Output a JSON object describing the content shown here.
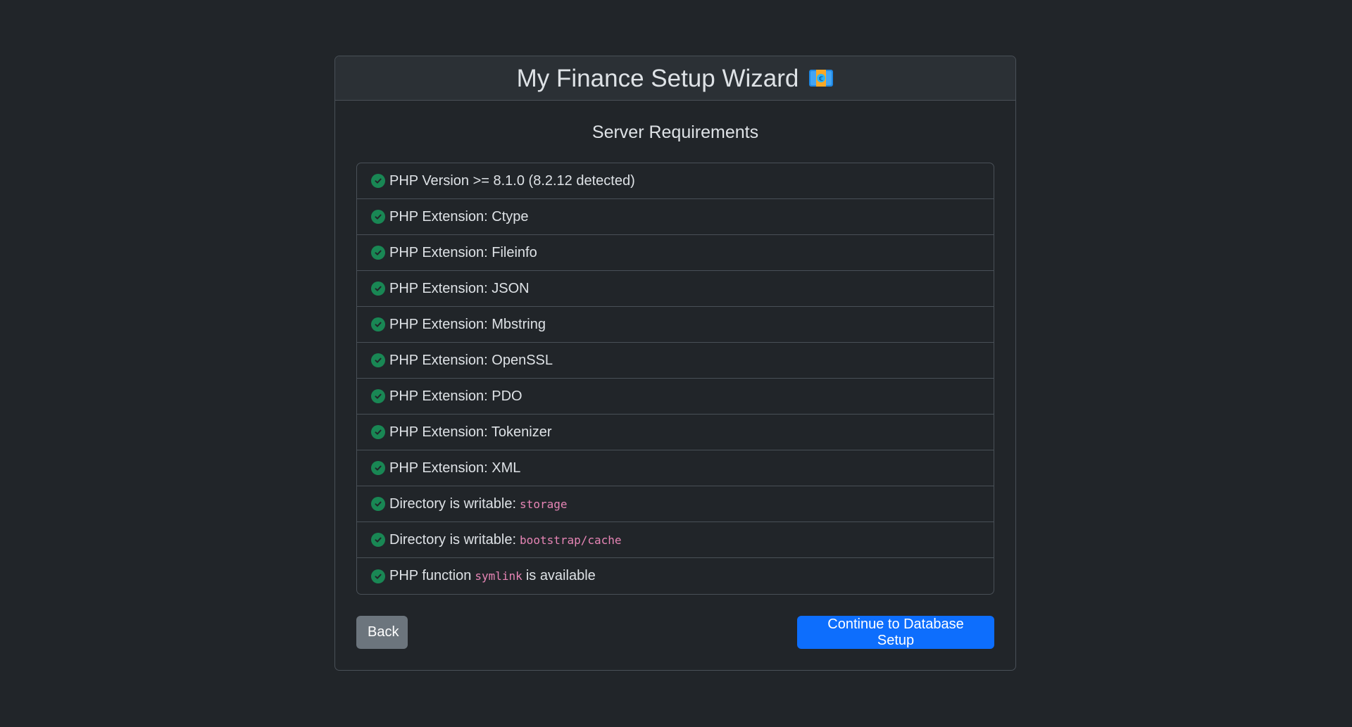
{
  "header": {
    "title": "My Finance Setup Wizard",
    "icon": "money-bill-icon"
  },
  "section": {
    "title": "Server Requirements"
  },
  "requirements": [
    {
      "text": "PHP Version >= 8.1.0 (8.2.12 detected)",
      "status": "pass"
    },
    {
      "text": "PHP Extension: Ctype",
      "status": "pass"
    },
    {
      "text": "PHP Extension: Fileinfo",
      "status": "pass"
    },
    {
      "text": "PHP Extension: JSON",
      "status": "pass"
    },
    {
      "text": "PHP Extension: Mbstring",
      "status": "pass"
    },
    {
      "text": "PHP Extension: OpenSSL",
      "status": "pass"
    },
    {
      "text": "PHP Extension: PDO",
      "status": "pass"
    },
    {
      "text": "PHP Extension: Tokenizer",
      "status": "pass"
    },
    {
      "text": "PHP Extension: XML",
      "status": "pass"
    },
    {
      "text": "Directory is writable:",
      "code": "storage",
      "status": "pass"
    },
    {
      "text": "Directory is writable:",
      "code": "bootstrap/cache",
      "status": "pass"
    },
    {
      "text": "PHP function",
      "code": "symlink",
      "after": "is available",
      "status": "pass"
    }
  ],
  "actions": {
    "back_label": "Back",
    "continue_label": "Continue to Database Setup"
  },
  "colors": {
    "background": "#212529",
    "success": "#198754",
    "primary": "#0d6efd",
    "secondary": "#6c757d",
    "code": "#e685b5"
  }
}
